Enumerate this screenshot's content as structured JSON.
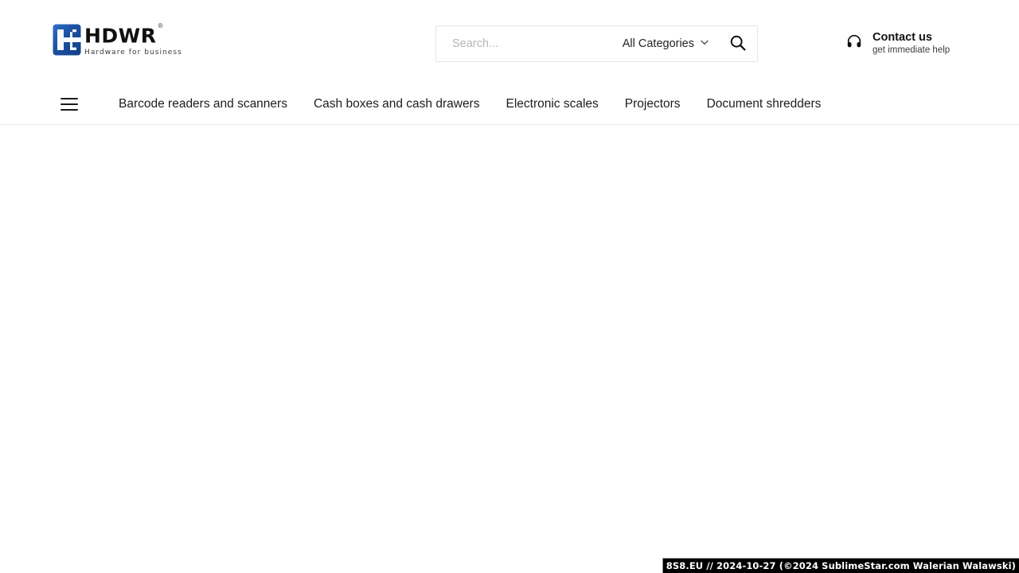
{
  "header": {
    "logo": {
      "word": "HDWR",
      "registered": "®",
      "tagline": "Hardware for business",
      "mark_icon": "hdwr-h-mark-icon",
      "mark_color": "#1b4fa0"
    },
    "search": {
      "placeholder": "Search...",
      "value": "",
      "category_label": "All Categories",
      "category_chevron_icon": "chevron-down-icon",
      "search_icon": "search-icon"
    },
    "contact": {
      "icon": "headphones-icon",
      "title": "Contact us",
      "subtitle": "get immediate help"
    }
  },
  "nav": {
    "menu_icon": "hamburger-menu-icon",
    "items": [
      {
        "label": "Barcode readers and scanners"
      },
      {
        "label": "Cash boxes and cash drawers"
      },
      {
        "label": "Electronic scales"
      },
      {
        "label": "Projectors"
      },
      {
        "label": "Document shredders"
      }
    ]
  },
  "watermark": {
    "text": "8S8.EU // 2024-10-27 (©2024 SublimeStar.com Walerian Walawski)"
  },
  "colors": {
    "brand_blue": "#1b4fa0",
    "text": "#1d1d1d",
    "border": "#e9eaec",
    "placeholder": "#b4b7ba",
    "watermark_bg": "#000000"
  }
}
